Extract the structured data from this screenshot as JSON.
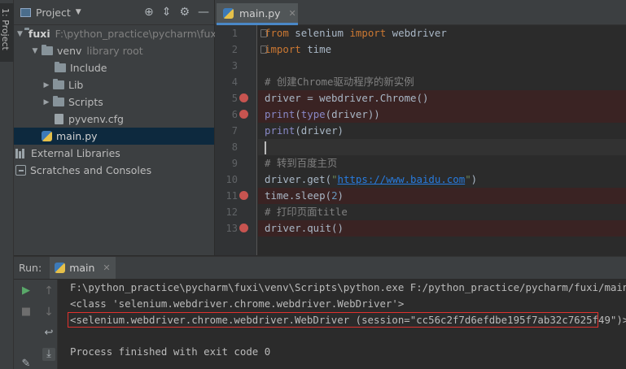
{
  "tool_strip": {
    "project_tab": "1: Project"
  },
  "project_panel": {
    "title": "Project",
    "header_icons": [
      "target-icon",
      "collapse-icon",
      "gear-icon",
      "minimize-icon"
    ],
    "root": {
      "name": "fuxi",
      "path": "F:\\python_practice\\pycharm\\fuxi"
    },
    "venv": {
      "name": "venv",
      "hint": "library root"
    },
    "venv_children": [
      "Include",
      "Lib",
      "Scripts",
      "pyvenv.cfg"
    ],
    "main_file": "main.py",
    "external_libraries": "External Libraries",
    "scratches": "Scratches and Consoles"
  },
  "editor": {
    "tab_label": "main.py",
    "lines": [
      {
        "n": "1"
      },
      {
        "n": "2"
      },
      {
        "n": "3"
      },
      {
        "n": "4"
      },
      {
        "n": "5"
      },
      {
        "n": "6"
      },
      {
        "n": "7"
      },
      {
        "n": "8"
      },
      {
        "n": "9"
      },
      {
        "n": "10"
      },
      {
        "n": "11"
      },
      {
        "n": "12"
      },
      {
        "n": "13"
      }
    ],
    "code": {
      "l1_kw1": "from",
      "l1_mod": " selenium ",
      "l1_kw2": "import",
      "l1_name": " webdriver",
      "l2_kw": "import",
      "l2_name": " time",
      "l4_comment": "# 创建Chrome驱动程序的新实例",
      "l5_text": "driver = webdriver.Chrome()",
      "l6_fn1": "print",
      "l6_p1": "(",
      "l6_fn2": "type",
      "l6_rest": "(driver))",
      "l7_fn": "print",
      "l7_rest": "(driver)",
      "l9_comment": "# 转到百度主页",
      "l10_pre": "driver.get(",
      "l10_q1": "\"",
      "l10_url": "https://www.baidu.com",
      "l10_q2": "\"",
      "l10_post": ")",
      "l11_pre": "time.sleep(",
      "l11_num": "2",
      "l11_post": ")",
      "l12_comment": "# 打印页面title",
      "l13_text": "driver.quit()"
    }
  },
  "run_panel": {
    "label": "Run:",
    "tab_label": "main",
    "console": [
      "F:\\python_practice\\pycharm\\fuxi\\venv\\Scripts\\python.exe F:/python_practice/pycharm/fuxi/main.py",
      "<class 'selenium.webdriver.chrome.webdriver.WebDriver'>",
      "<selenium.webdriver.chrome.webdriver.WebDriver (session=\"cc56c2f7d6efdbe195f7ab32c7625f49\")>",
      "",
      "Process finished with exit code 0"
    ]
  },
  "colors": {
    "breakpoint": "#c75450",
    "keyword": "#cc7832",
    "builtin": "#8888c6",
    "comment": "#808080",
    "url": "#287bde",
    "highlight_border": "#e0312e"
  }
}
